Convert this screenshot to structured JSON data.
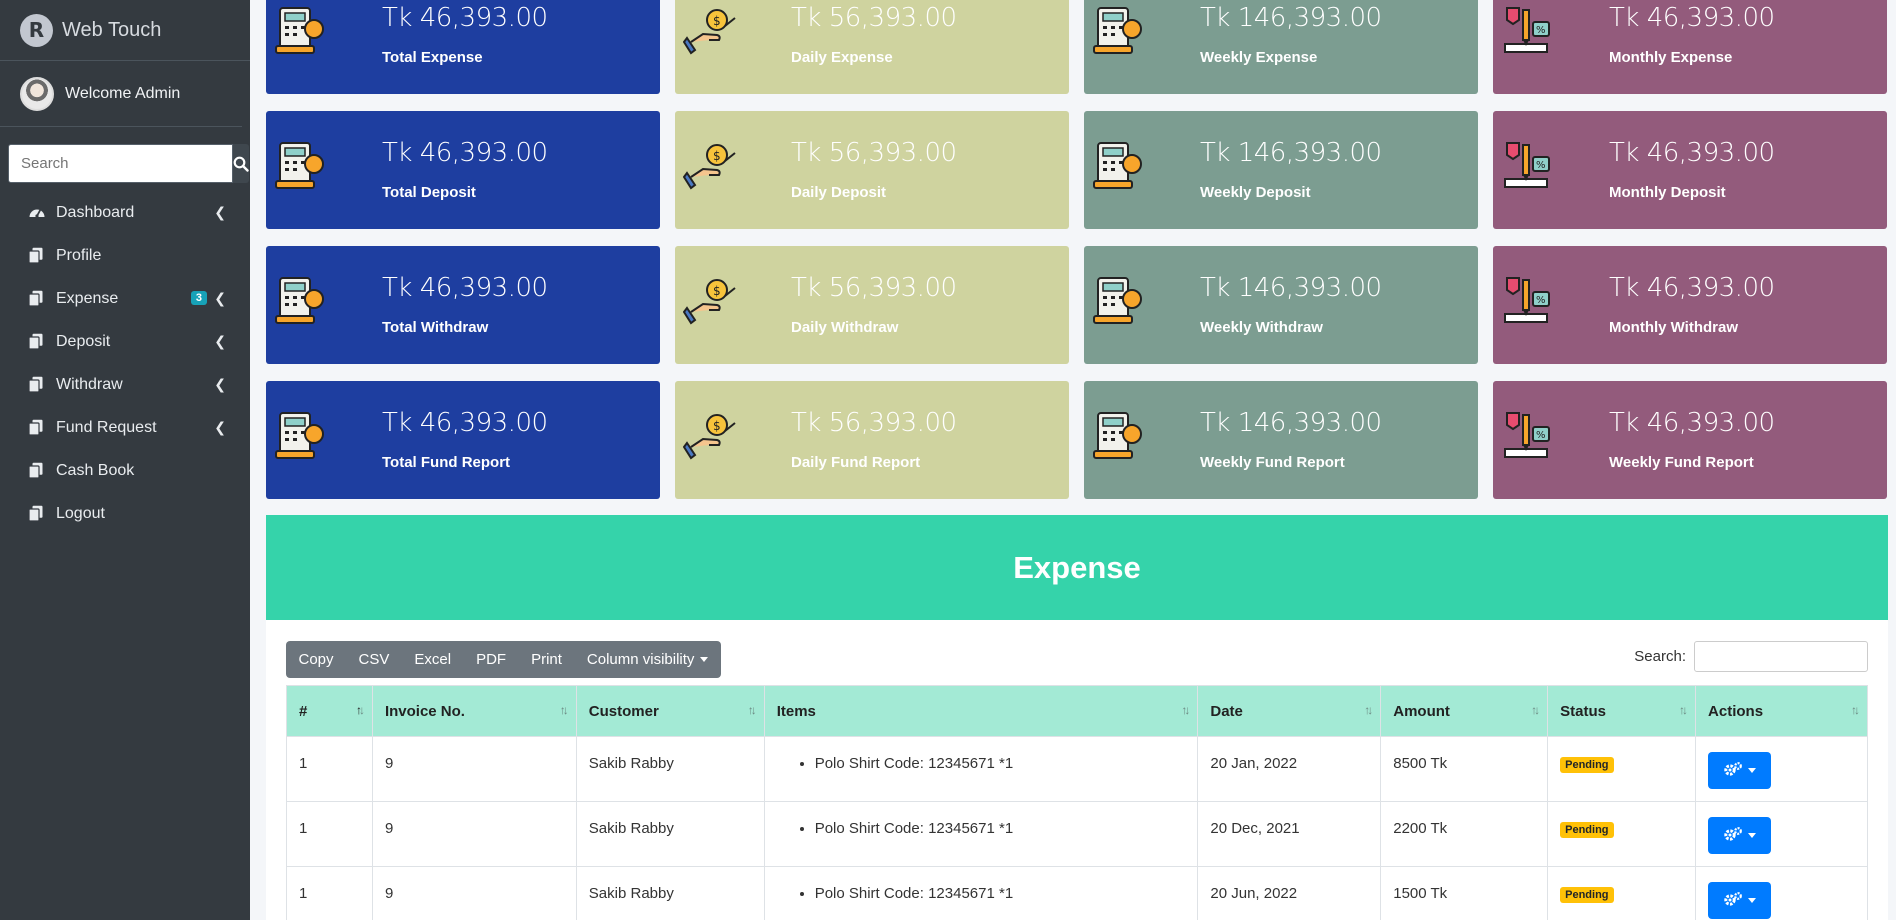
{
  "sidebar": {
    "brand": "Web Touch",
    "brand_letter": "R",
    "user": "Welcome Admin",
    "search_placeholder": "Search",
    "items": [
      {
        "label": "Dashboard",
        "arrow": true,
        "icon": "dashboard-icon"
      },
      {
        "label": "Profile",
        "arrow": false,
        "icon": "copy-icon"
      },
      {
        "label": "Expense",
        "arrow": true,
        "badge": "3",
        "icon": "copy-icon"
      },
      {
        "label": "Deposit",
        "arrow": true,
        "icon": "copy-icon"
      },
      {
        "label": "Withdraw",
        "arrow": true,
        "icon": "copy-icon"
      },
      {
        "label": "Fund Request",
        "arrow": true,
        "icon": "copy-icon"
      },
      {
        "label": "Cash Book",
        "arrow": false,
        "icon": "copy-icon"
      },
      {
        "label": "Logout",
        "arrow": false,
        "icon": "copy-icon"
      }
    ]
  },
  "cards": [
    {
      "amount": "Tk 46,393.00",
      "label": "Total Expense"
    },
    {
      "amount": "Tk 56,393.00",
      "label": "Daily Expense"
    },
    {
      "amount": "Tk 146,393.00",
      "label": "Weekly Expense"
    },
    {
      "amount": "Tk 46,393.00",
      "label": "Monthly Expense"
    },
    {
      "amount": "Tk 46,393.00",
      "label": "Total Deposit"
    },
    {
      "amount": "Tk 56,393.00",
      "label": "Daily Deposit"
    },
    {
      "amount": "Tk 146,393.00",
      "label": "Weekly Deposit"
    },
    {
      "amount": "Tk 46,393.00",
      "label": "Monthly Deposit"
    },
    {
      "amount": "Tk 46,393.00",
      "label": "Total Withdraw"
    },
    {
      "amount": "Tk 56,393.00",
      "label": "Daily Withdraw"
    },
    {
      "amount": "Tk 146,393.00",
      "label": "Weekly Withdraw"
    },
    {
      "amount": "Tk 46,393.00",
      "label": "Monthly Withdraw"
    },
    {
      "amount": "Tk 46,393.00",
      "label": "Total Fund Report"
    },
    {
      "amount": "Tk 56,393.00",
      "label": "Daily Fund Report"
    },
    {
      "amount": "Tk 146,393.00",
      "label": "Weekly Fund Report"
    },
    {
      "amount": "Tk 46,393.00",
      "label": "Weekly Fund Report"
    }
  ],
  "card_colors": {
    "blue": "#1e3ea0",
    "khaki": "#cfd39f",
    "sage": "#7c9d91",
    "plum": "#935b7c"
  },
  "expense": {
    "title": "Expense",
    "buttons": [
      "Copy",
      "CSV",
      "Excel",
      "PDF",
      "Print",
      "Column visibility"
    ],
    "search_label": "Search:",
    "columns": [
      "#",
      "Invoice No.",
      "Customer",
      "Items",
      "Date",
      "Amount",
      "Status",
      "Actions"
    ],
    "rows": [
      {
        "num": "1",
        "invoice": "9",
        "customer": "Sakib Rabby",
        "item": "Polo Shirt Code: 12345671 *1",
        "date": "20 Jan, 2022",
        "amount": "8500 Tk",
        "status": "Pending"
      },
      {
        "num": "1",
        "invoice": "9",
        "customer": "Sakib Rabby",
        "item": "Polo Shirt Code: 12345671 *1",
        "date": "20 Dec, 2021",
        "amount": "2200 Tk",
        "status": "Pending"
      },
      {
        "num": "1",
        "invoice": "9",
        "customer": "Sakib Rabby",
        "item": "Polo Shirt Code: 12345671 *1",
        "date": "20 Jun, 2022",
        "amount": "1500 Tk",
        "status": "Pending"
      }
    ]
  },
  "accent": {
    "header": "#35d3aa",
    "table_head": "#a3ead5",
    "action": "#007bff",
    "pending": "#ffc107"
  }
}
